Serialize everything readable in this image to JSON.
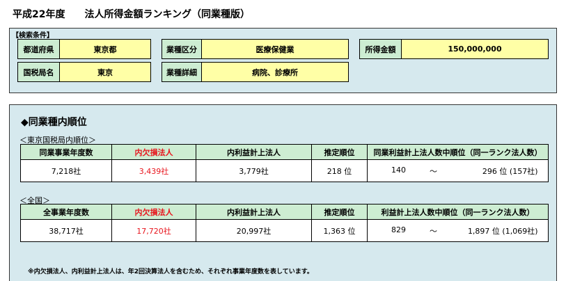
{
  "header": {
    "title": "平成22年度　　法人所得金額ランキング（同業種版）"
  },
  "search": {
    "label": "【検索条件】",
    "prefecture_label": "都道府県",
    "prefecture_value": "東京都",
    "industry_class_label": "業種区分",
    "industry_class_value": "医療保健業",
    "income_label": "所得金額",
    "income_value": "150,000,000",
    "tax_bureau_label": "国税局名",
    "tax_bureau_value": "東京",
    "industry_detail_label": "業種詳細",
    "industry_detail_value": "病院、診療所"
  },
  "ranking": {
    "title": "◆同業種内順位",
    "bureau": {
      "label": "＜東京国税局内順位＞",
      "headers": [
        "同業事業年度数",
        "内欠損法人",
        "内利益計上法人",
        "推定順位",
        "同業利益計上法人数中順位（同一ランク法人数）"
      ],
      "total": "7,218社",
      "deficit": "3,439社",
      "profit": "3,779社",
      "estimated_rank": "218 位",
      "range_from": "140",
      "range_sep": "～",
      "range_to": "296 位 (157社)"
    },
    "national": {
      "label": "＜全国＞",
      "headers": [
        "全事業年度数",
        "内欠損法人",
        "内利益計上法人",
        "推定順位",
        "利益計上法人数中順位（同一ランク法人数）"
      ],
      "total": "38,717社",
      "deficit": "17,720社",
      "profit": "20,997社",
      "estimated_rank": "1,363 位",
      "range_from": "829",
      "range_sep": "～",
      "range_to": "1,897 位 (1,069社)"
    },
    "note": "※内欠損法人、内利益計上法人は、年2回決算法人を含むため、それぞれ事業年度数を表しています。"
  },
  "colors": {
    "panel_bg": "#d6e9ee",
    "label_bg": "#cdedd2",
    "value_bg": "#ffffa6",
    "deficit_header": "#e8141c"
  }
}
